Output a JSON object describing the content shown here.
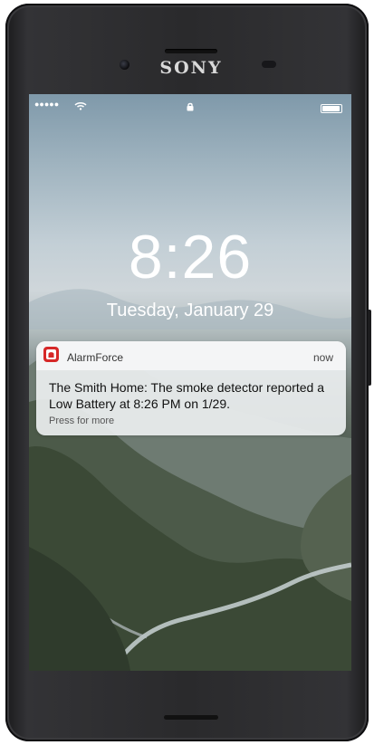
{
  "device": {
    "brand": "SONY"
  },
  "status_bar": {
    "signal": "●●●●●"
  },
  "lockscreen": {
    "time": "8:26",
    "date": "Tuesday, January 29"
  },
  "notification": {
    "app_name": "AlarmForce",
    "timestamp": "now",
    "message": "The Smith Home: The smoke detector reported a Low Battery at 8:26 PM on 1/29.",
    "action_hint": "Press for more"
  },
  "colors": {
    "app_icon": "#d62828"
  }
}
